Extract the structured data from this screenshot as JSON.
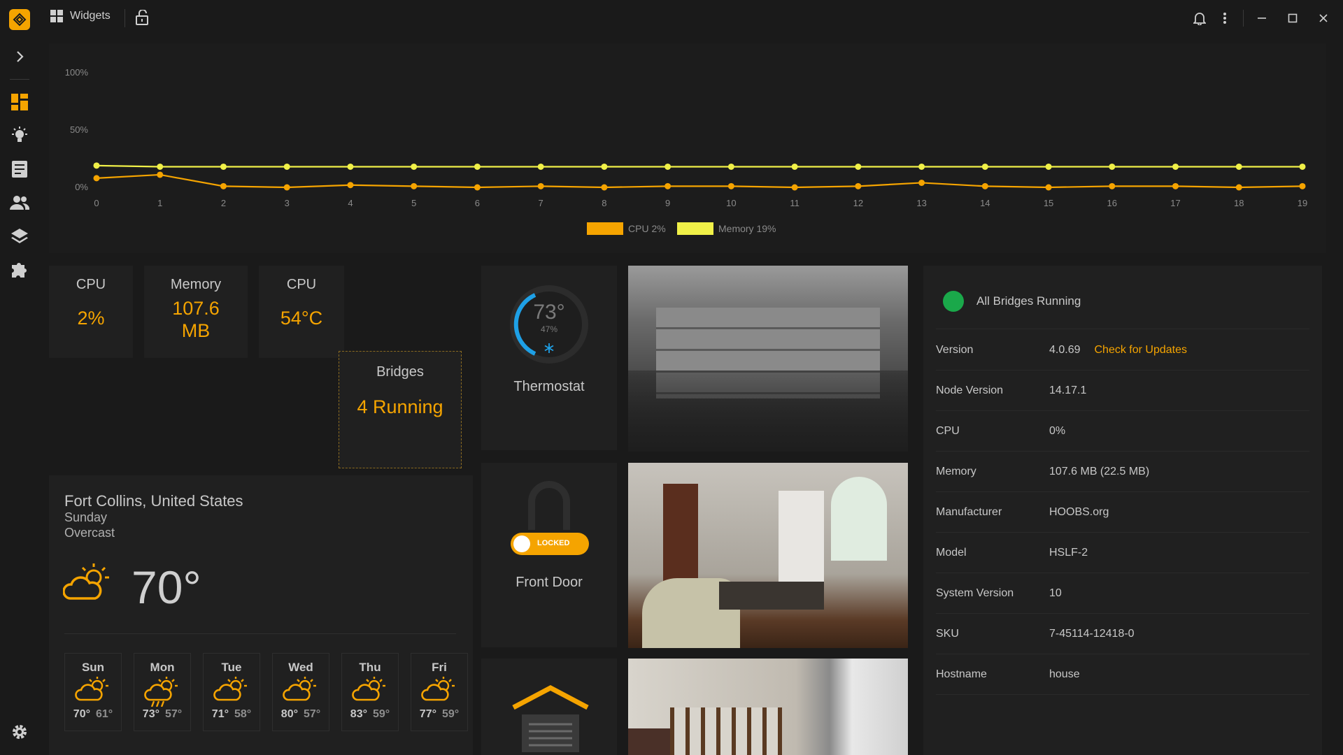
{
  "titlebar": {
    "app_title": "Widgets"
  },
  "chart_data": {
    "type": "line",
    "x": [
      0,
      1,
      2,
      3,
      4,
      5,
      6,
      7,
      8,
      9,
      10,
      11,
      12,
      13,
      14,
      15,
      16,
      17,
      18,
      19
    ],
    "ytick_labels": [
      "100%",
      "50%",
      "0%"
    ],
    "ylim": [
      0,
      100
    ],
    "series": [
      {
        "name": "CPU 2%",
        "color": "#f5a400",
        "values": [
          8,
          11,
          1,
          0,
          2,
          1,
          0,
          1,
          0,
          1,
          1,
          0,
          1,
          4,
          1,
          0,
          1,
          1,
          0,
          1
        ]
      },
      {
        "name": "Memory 19%",
        "color": "#f0f048",
        "values": [
          19,
          18,
          18,
          18,
          18,
          18,
          18,
          18,
          18,
          18,
          18,
          18,
          18,
          18,
          18,
          18,
          18,
          18,
          18,
          18
        ]
      }
    ]
  },
  "tiles": {
    "cpu": {
      "title": "CPU",
      "value": "2%"
    },
    "memory": {
      "title": "Memory",
      "value_line1": "107.6",
      "value_line2": "MB"
    },
    "cpu_temp": {
      "title": "CPU",
      "value": "54°C"
    },
    "bridges": {
      "title": "Bridges",
      "value": "4 Running"
    }
  },
  "weather": {
    "location": "Fort Collins, United States",
    "day": "Sunday",
    "condition": "Overcast",
    "temperature": "70°",
    "forecast": [
      {
        "day": "Sun",
        "high": "70°",
        "low": "61°",
        "icon": "partly-sunny-icon"
      },
      {
        "day": "Mon",
        "high": "73°",
        "low": "57°",
        "icon": "sun-rain-icon"
      },
      {
        "day": "Tue",
        "high": "71°",
        "low": "58°",
        "icon": "partly-sunny-icon"
      },
      {
        "day": "Wed",
        "high": "80°",
        "low": "57°",
        "icon": "partly-sunny-icon"
      },
      {
        "day": "Thu",
        "high": "83°",
        "low": "59°",
        "icon": "partly-sunny-icon"
      },
      {
        "day": "Fri",
        "high": "77°",
        "low": "59°",
        "icon": "partly-sunny-icon"
      }
    ]
  },
  "devices": {
    "thermostat": {
      "label": "Thermostat",
      "temp": "73°",
      "humidity": "47%",
      "mode_icon": "snowflake-icon"
    },
    "front_door": {
      "label": "Front Door",
      "status": "LOCKED"
    },
    "garage": {
      "icon": "garage-icon"
    }
  },
  "system": {
    "status": "All Bridges Running",
    "status_color": "#1aa84a",
    "check_updates": "Check for Updates",
    "rows": [
      {
        "key": "Version",
        "value": "4.0.69"
      },
      {
        "key": "Node Version",
        "value": "14.17.1"
      },
      {
        "key": "CPU",
        "value": "0%"
      },
      {
        "key": "Memory",
        "value": "107.6 MB (22.5 MB)"
      },
      {
        "key": "Manufacturer",
        "value": "HOOBS.org"
      },
      {
        "key": "Model",
        "value": "HSLF-2"
      },
      {
        "key": "System Version",
        "value": "10"
      },
      {
        "key": "SKU",
        "value": "7-45114-12418-0"
      },
      {
        "key": "Hostname",
        "value": "house"
      }
    ]
  },
  "colors": {
    "accent": "#f5a400",
    "memory_line": "#f0f048",
    "thermo_ring": "#1ea0e6"
  }
}
